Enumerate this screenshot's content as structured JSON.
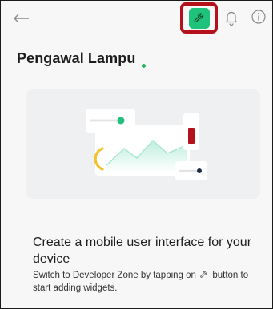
{
  "header": {
    "back_icon": "arrow-left-icon",
    "developer_button_icon": "wrench-icon",
    "notifications_icon": "bell-icon",
    "info_icon": "info-icon",
    "accent_color": "#1ec27b",
    "highlight_color": "#b3121b"
  },
  "device": {
    "name": "Pengawal Lampu",
    "status_color": "#28b36b"
  },
  "empty_state": {
    "illustration": "dashboard-widgets-illustration",
    "headline": "Create a mobile user interface for your device",
    "desc_before_icon": "Switch to Developer Zone by tapping on",
    "desc_icon": "wrench-icon",
    "desc_after_icon": "button to start adding widgets."
  }
}
